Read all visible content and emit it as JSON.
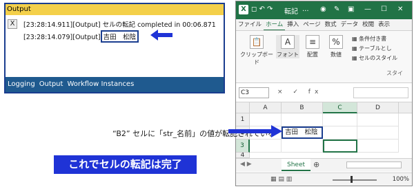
{
  "output_panel": {
    "title": "Output",
    "close_label": "X",
    "line1": "[23:28:14.911][Output] セルの転記 completed in 00:06.871",
    "line2_prefix": "[23:28:14.079][Output]",
    "line2_value": "吉田　松陰",
    "tabs": [
      {
        "label": "Logging"
      },
      {
        "label": "Output"
      },
      {
        "label": "Workflow Instances"
      }
    ]
  },
  "excel": {
    "title_text": "転記",
    "title_suffix": "...",
    "ribbon_tabs": [
      "ファイル",
      "ホーム",
      "挿入",
      "ページ",
      "数式",
      "データ",
      "校閲",
      "表示"
    ],
    "ribbon_groups": {
      "clipboard": "クリップボード",
      "font": "フォント",
      "align": "配置",
      "number": "数値",
      "conditional": "条件付き書",
      "table": "テーブルとし",
      "cellstyle": "セルのスタイル",
      "style_group": "スタイ"
    },
    "name_box": "C3",
    "formula_icons": "× ✓ fx",
    "columns": [
      "A",
      "B",
      "C",
      "D"
    ],
    "rows": [
      "1",
      "2",
      "3",
      "4"
    ],
    "cell_b2": "吉田　松陰",
    "sheet_tab": "Sheet",
    "zoom": "100%"
  },
  "annotation": {
    "label": "“B2” セルに「str_名前」の値が転記されている",
    "banner": "これでセルの転記は完了"
  },
  "colors": {
    "excel_green": "#217346",
    "highlight_blue": "#1a3d8f",
    "banner_blue": "#1f33d6",
    "output_title_yellow": "#f4d04a"
  }
}
